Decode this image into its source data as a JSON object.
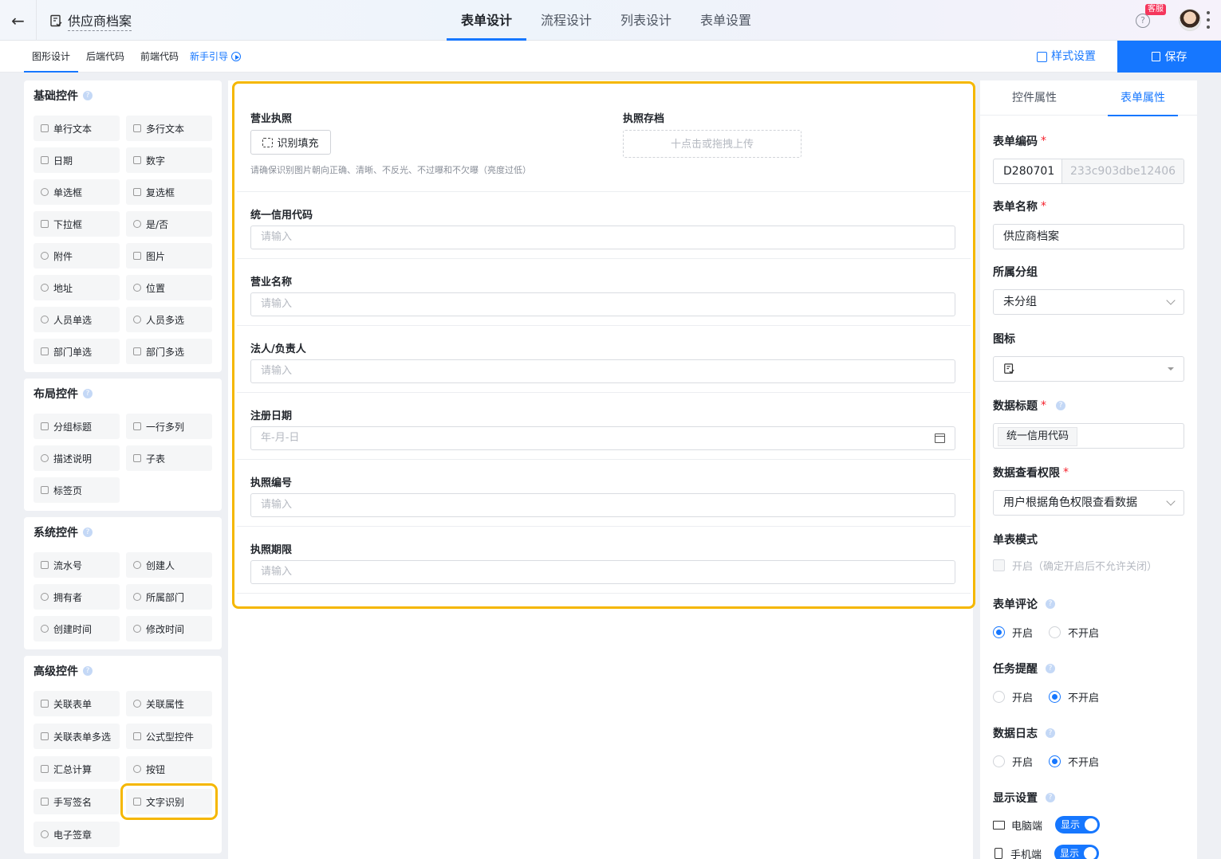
{
  "header": {
    "back": "←",
    "app_title": "供应商档案",
    "tabs": [
      {
        "label": "表单设计",
        "active": true
      },
      {
        "label": "流程设计",
        "active": false
      },
      {
        "label": "列表设计",
        "active": false
      },
      {
        "label": "表单设置",
        "active": false
      }
    ],
    "help": "?",
    "kefu_badge": "客服"
  },
  "subbar": {
    "tabs": [
      "图形设计",
      "后端代码",
      "前端代码"
    ],
    "guide": "新手引导",
    "style_settings": "样式设置",
    "save": "保存"
  },
  "palette": {
    "groups": [
      {
        "title": "基础控件",
        "items": [
          "单行文本",
          "多行文本",
          "日期",
          "数字",
          "单选框",
          "复选框",
          "下拉框",
          "是/否",
          "附件",
          "图片",
          "地址",
          "位置",
          "人员单选",
          "人员多选",
          "部门单选",
          "部门多选"
        ]
      },
      {
        "title": "布局控件",
        "items": [
          "分组标题",
          "一行多列",
          "描述说明",
          "子表",
          "标签页"
        ]
      },
      {
        "title": "系统控件",
        "items": [
          "流水号",
          "创建人",
          "拥有者",
          "所属部门",
          "创建时间",
          "修改时间"
        ]
      },
      {
        "title": "高级控件",
        "items": [
          "关联表单",
          "关联属性",
          "关联表单多选",
          "公式型控件",
          "汇总计算",
          "按钮",
          "手写签名",
          "文字识别",
          "电子签章"
        ]
      }
    ]
  },
  "form": {
    "license": {
      "label": "营业执照",
      "ocr_button": "识别填充",
      "hint": "请确保识别图片朝向正确、清晰、不反光、不过曝和不欠曝（亮度过低）"
    },
    "archive": {
      "label": "执照存档",
      "upload": "十点击或拖拽上传"
    },
    "fields": [
      {
        "label": "统一信用代码",
        "placeholder": "请输入"
      },
      {
        "label": "营业名称",
        "placeholder": "请输入"
      },
      {
        "label": "法人/负责人",
        "placeholder": "请输入"
      },
      {
        "label": "注册日期",
        "placeholder": "年-月-日"
      },
      {
        "label": "执照编号",
        "placeholder": "请输入"
      },
      {
        "label": "执照期限",
        "placeholder": "请输入"
      }
    ]
  },
  "right_panel": {
    "tabs": [
      "控件属性",
      "表单属性"
    ],
    "form_code": {
      "label": "表单编码",
      "prefix": "D280701",
      "suffix": "233c903dbe12406"
    },
    "form_name": {
      "label": "表单名称",
      "value": "供应商档案"
    },
    "group": {
      "label": "所属分组",
      "value": "未分组"
    },
    "icon": {
      "label": "图标"
    },
    "data_title": {
      "label": "数据标题",
      "tag": "统一信用代码"
    },
    "view_perm": {
      "label": "数据查看权限",
      "value": "用户根据角色权限查看数据"
    },
    "single_mode": {
      "label": "单表模式",
      "option": "开启（确定开启后不允许关闭）"
    },
    "comments": {
      "label": "表单评论",
      "on": "开启",
      "off": "不开启"
    },
    "reminder": {
      "label": "任务提醒",
      "on": "开启",
      "off": "不开启"
    },
    "log": {
      "label": "数据日志",
      "on": "开启",
      "off": "不开启"
    },
    "display": {
      "label": "显示设置",
      "pc": "电脑端",
      "mobile": "手机端",
      "show": "显示"
    }
  }
}
